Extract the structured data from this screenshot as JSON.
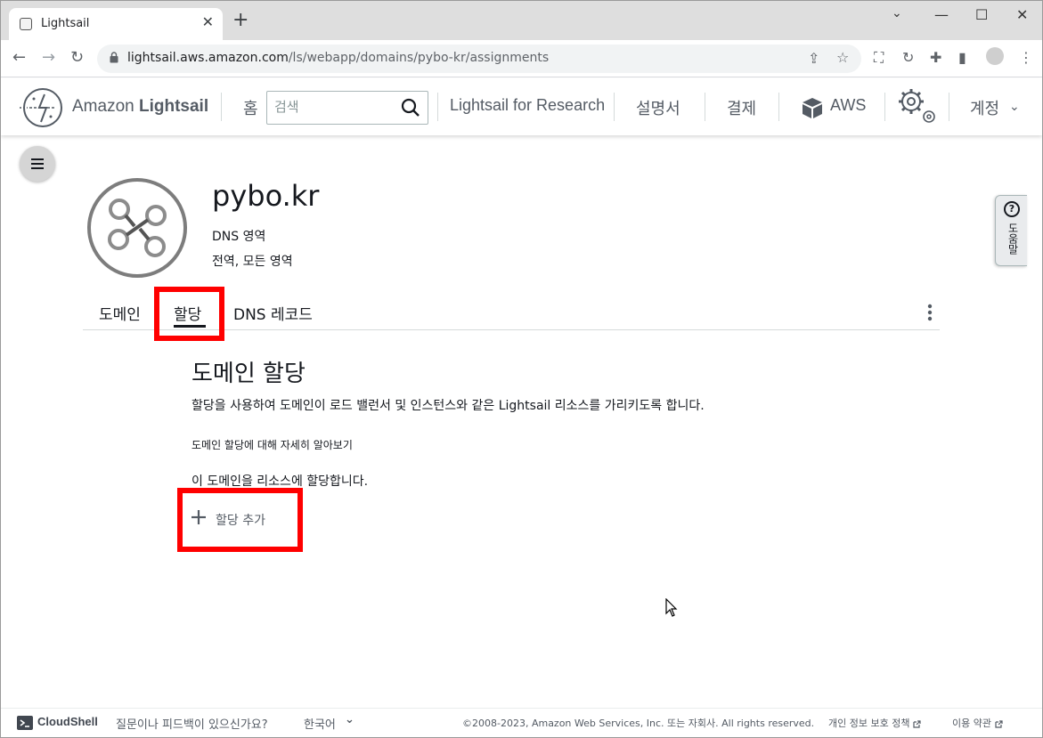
{
  "browser": {
    "tab_title": "Lightsail",
    "tab_close": "✕",
    "new_tab": "+",
    "url_host": "lightsail.aws.amazon.com",
    "url_path": "/ls/webapp/domains/pybo-kr/assignments",
    "window_controls": {
      "minimize": "—",
      "maximize": "☐",
      "close": "✕"
    }
  },
  "header": {
    "brand_prefix": "Amazon ",
    "brand_name": "Lightsail",
    "home": "홈",
    "search_placeholder": "검색",
    "research": "Lightsail for Research",
    "docs": "설명서",
    "billing": "결제",
    "aws": "AWS",
    "account": "계정"
  },
  "help_tab": {
    "icon": "?",
    "label": "도움말"
  },
  "resource": {
    "title": "pybo.kr",
    "type": "DNS 영역",
    "region": "전역, 모든 영역"
  },
  "tabs": [
    {
      "label": "도메인",
      "active": false
    },
    {
      "label": "할당",
      "active": true
    },
    {
      "label": "DNS 레코드",
      "active": false
    }
  ],
  "content": {
    "section_title": "도메인 할당",
    "description": "할당을 사용하여 도메인이 로드 밸런서 및 인스턴스와 같은 Lightsail 리소스를 가리키도록 합니다.",
    "learn_more": "도메인 할당에 대해 자세히 알아보기",
    "assign_text": "이 도메인을 리소스에 할당합니다.",
    "add_button": "할당 추가"
  },
  "footer": {
    "cloudshell": "CloudShell",
    "feedback": "질문이나 피드백이 있으신가요?",
    "language": "한국어",
    "copyright": "©2008-2023, Amazon Web Services, Inc. 또는 자회사. All rights reserved.",
    "privacy": "개인 정보 보호 정책",
    "terms": "이용 약관"
  },
  "colors": {
    "highlight": "#ff0000",
    "text_primary": "#16191f",
    "text_secondary": "#545b64"
  }
}
